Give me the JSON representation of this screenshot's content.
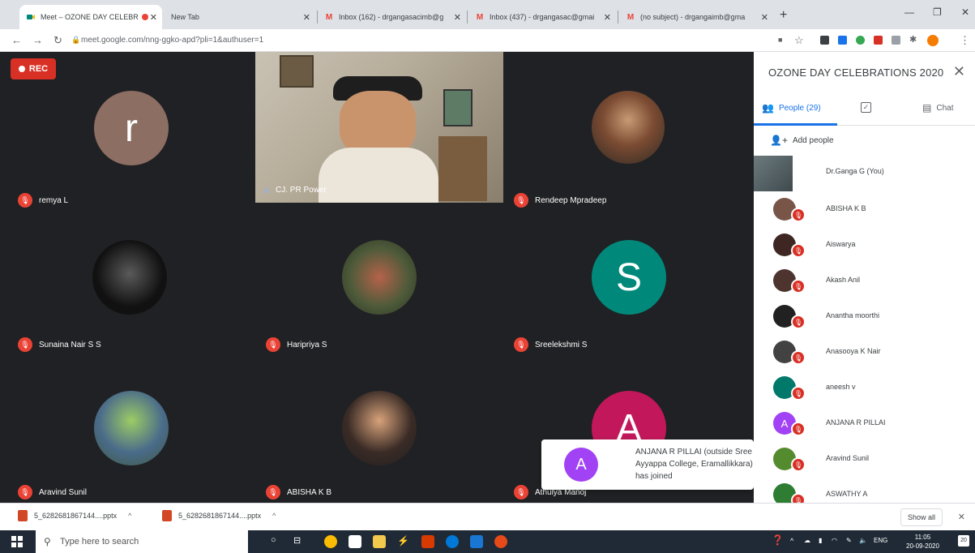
{
  "browser": {
    "tabs": [
      {
        "title": "Meet – OZONE DAY CELEBR",
        "icon": "meet-icon",
        "active": true
      },
      {
        "title": "New Tab",
        "icon": "",
        "active": false
      },
      {
        "title": "Inbox (162) - drgangasacimb@g",
        "icon": "gmail-icon",
        "active": false
      },
      {
        "title": "Inbox (437) - drgangasac@gmai",
        "icon": "gmail-icon",
        "active": false
      },
      {
        "title": "(no subject) - drgangaimb@gma",
        "icon": "gmail-icon",
        "active": false
      }
    ],
    "url": "meet.google.com/nng-ggko-apd?pli=1&authuser=1"
  },
  "meet": {
    "rec_label": "REC",
    "tiles": [
      {
        "name": "remya L",
        "type": "letter",
        "letter": "r",
        "color": "#8d6e63",
        "muted": true
      },
      {
        "name": "CJ. PR Power",
        "type": "video",
        "muted": false
      },
      {
        "name": "Rendeep Mpradeep",
        "type": "photo",
        "color": "#5d4037",
        "muted": true
      },
      {
        "name": "Sunaina Nair S S",
        "type": "photo",
        "color": "#1c1c1c",
        "muted": true
      },
      {
        "name": "Haripriya S",
        "type": "photo",
        "color": "#4e5b3a",
        "muted": true
      },
      {
        "name": "Sreelekshmi S",
        "type": "letter",
        "letter": "S",
        "color": "#00897b",
        "muted": true
      },
      {
        "name": "Aravind Sunil",
        "type": "photo",
        "color": "#6b8e6b",
        "muted": true
      },
      {
        "name": "ABISHA K B",
        "type": "photo",
        "color": "#7a6a5a",
        "muted": true
      },
      {
        "name": "Athulya Manoj",
        "type": "letter",
        "letter": "A",
        "color": "#c2185b",
        "muted": true
      }
    ],
    "toast": {
      "letter": "A",
      "message": "ANJANA R PILLAI (outside Sree Ayyappa College, Eramallikkara) has joined"
    }
  },
  "panel": {
    "title": "OZONE DAY CELEBRATIONS 2020",
    "tabs": {
      "people": "People (29)",
      "chat": "Chat"
    },
    "add_people": "Add people",
    "people": [
      {
        "name": "Dr.Ganga G (You)",
        "self": true
      },
      {
        "name": "ABISHA K B",
        "color": "#795548"
      },
      {
        "name": "Aiswarya",
        "color": "#3e2723"
      },
      {
        "name": "Akash Anil",
        "color": "#4e342e"
      },
      {
        "name": "Anantha moorthi",
        "color": "#212121"
      },
      {
        "name": "Anasooya K Nair",
        "color": "#424242"
      },
      {
        "name": "aneesh v",
        "color": "#00796b"
      },
      {
        "name": "ANJANA R PILLAI",
        "letter": "A",
        "color": "#a142f4"
      },
      {
        "name": "Aravind Sunil",
        "color": "#558b2f"
      },
      {
        "name": "ASWATHY A",
        "color": "#2e7d32"
      }
    ]
  },
  "downloads": {
    "items": [
      "5_6282681867144....pptx",
      "5_6282681867144....pptx"
    ],
    "show_all": "Show all"
  },
  "taskbar": {
    "search_placeholder": "Type here to search",
    "lang": "ENG",
    "time": "11:05",
    "date": "20-09-2020",
    "notif_count": "20"
  }
}
